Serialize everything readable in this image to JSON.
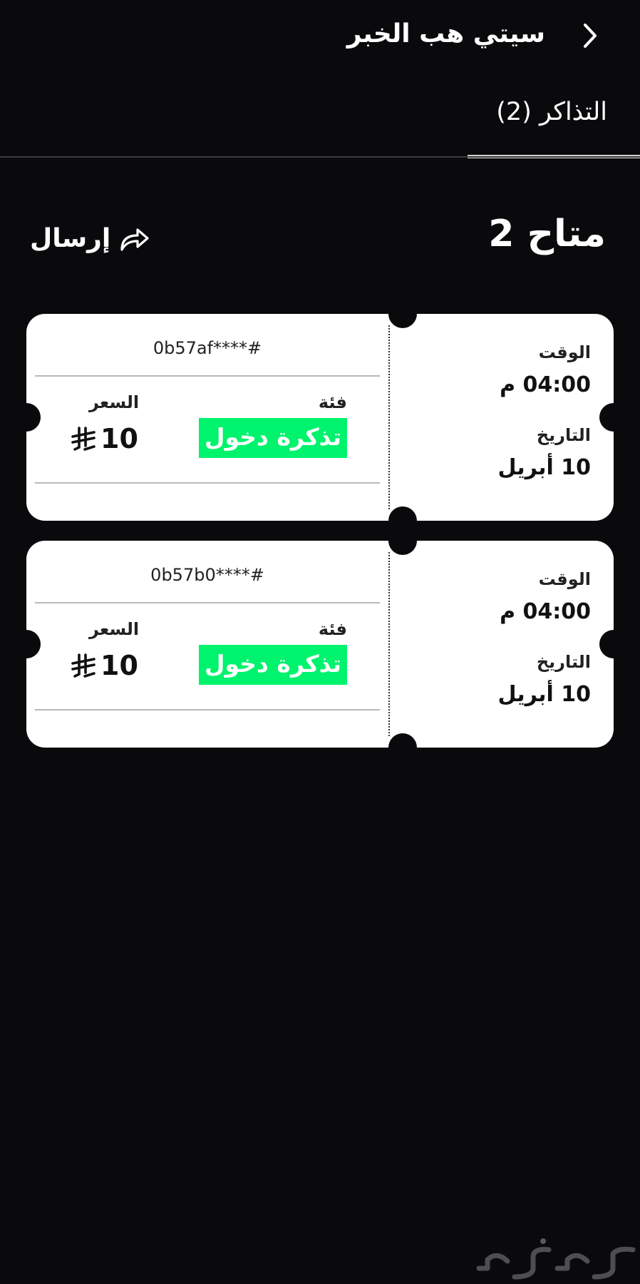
{
  "header": {
    "title": "سيتي هب الخبر"
  },
  "tabs": [
    {
      "label": "التذاكر (2)",
      "active": true
    }
  ],
  "section": {
    "title": "متاح 2",
    "send_label": "إرسال"
  },
  "tickets": [
    {
      "id": "0b57af****#",
      "time_label": "الوقت",
      "time": "04:00 م",
      "date_label": "التاريخ",
      "date": "10 أبريل",
      "category_label": "فئة",
      "category": "تذكرة دخول",
      "price_label": "السعر",
      "price": "10"
    },
    {
      "id": "0b57b0****#",
      "time_label": "الوقت",
      "time": "04:00 م",
      "date_label": "التاريخ",
      "date": "10 أبريل",
      "category_label": "فئة",
      "category": "تذكرة دخول",
      "price_label": "السعر",
      "price": "10"
    }
  ],
  "colors": {
    "background": "#0a0a0c",
    "accent_green": "#00f36c",
    "ticket_bg": "#ffffff"
  },
  "icons": {
    "back": "chevron-right-icon",
    "send": "share-arrow-icon",
    "currency": "saudi-riyal-icon"
  }
}
